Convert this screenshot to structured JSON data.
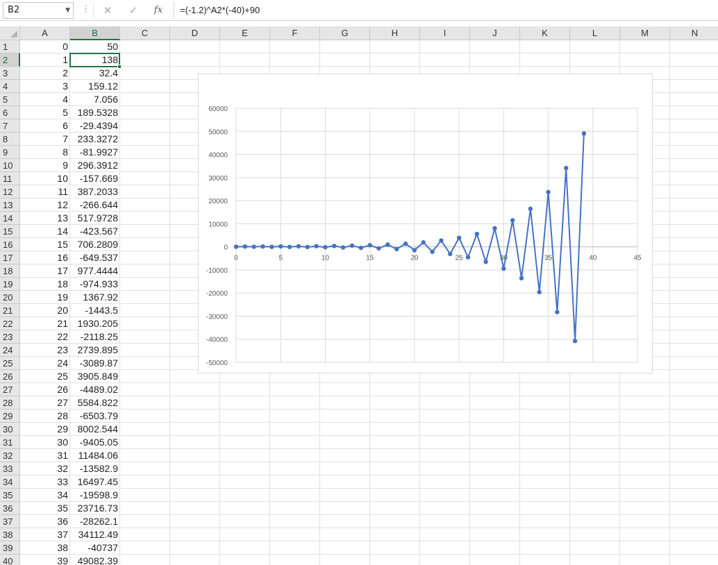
{
  "formula_bar": {
    "name_box": "B2",
    "name_box_icon": "chevron-down-icon",
    "more_icon": "vertical-dots-icon",
    "cancel_label": "✕",
    "enter_label": "✓",
    "fx_label": "fx",
    "formula": "=(-1.2)^A2*(-40)+90"
  },
  "columns": [
    "A",
    "B",
    "C",
    "D",
    "E",
    "F",
    "G",
    "H",
    "I",
    "J",
    "K",
    "L",
    "M",
    "N"
  ],
  "selected_column": "B",
  "selected_row": 2,
  "rows": [
    {
      "n": "1",
      "a": "0",
      "b": "50"
    },
    {
      "n": "2",
      "a": "1",
      "b": "138"
    },
    {
      "n": "3",
      "a": "2",
      "b": "32.4"
    },
    {
      "n": "4",
      "a": "3",
      "b": "159.12"
    },
    {
      "n": "5",
      "a": "4",
      "b": "7.056"
    },
    {
      "n": "6",
      "a": "5",
      "b": "189.5328"
    },
    {
      "n": "7",
      "a": "6",
      "b": "-29.4394"
    },
    {
      "n": "8",
      "a": "7",
      "b": "233.3272"
    },
    {
      "n": "9",
      "a": "8",
      "b": "-81.9927"
    },
    {
      "n": "10",
      "a": "9",
      "b": "296.3912"
    },
    {
      "n": "11",
      "a": "10",
      "b": "-157.669"
    },
    {
      "n": "12",
      "a": "11",
      "b": "387.2033"
    },
    {
      "n": "13",
      "a": "12",
      "b": "-266.644"
    },
    {
      "n": "14",
      "a": "13",
      "b": "517.9728"
    },
    {
      "n": "15",
      "a": "14",
      "b": "-423.567"
    },
    {
      "n": "16",
      "a": "15",
      "b": "706.2809"
    },
    {
      "n": "17",
      "a": "16",
      "b": "-649.537"
    },
    {
      "n": "18",
      "a": "17",
      "b": "977.4444"
    },
    {
      "n": "19",
      "a": "18",
      "b": "-974.933"
    },
    {
      "n": "20",
      "a": "19",
      "b": "1367.92"
    },
    {
      "n": "21",
      "a": "20",
      "b": "-1443.5"
    },
    {
      "n": "22",
      "a": "21",
      "b": "1930.205"
    },
    {
      "n": "23",
      "a": "22",
      "b": "-2118.25"
    },
    {
      "n": "24",
      "a": "23",
      "b": "2739.895"
    },
    {
      "n": "25",
      "a": "24",
      "b": "-3089.87"
    },
    {
      "n": "26",
      "a": "25",
      "b": "3905.849"
    },
    {
      "n": "27",
      "a": "26",
      "b": "-4489.02"
    },
    {
      "n": "28",
      "a": "27",
      "b": "5584.822"
    },
    {
      "n": "29",
      "a": "28",
      "b": "-6503.79"
    },
    {
      "n": "30",
      "a": "29",
      "b": "8002.544"
    },
    {
      "n": "31",
      "a": "30",
      "b": "-9405.05"
    },
    {
      "n": "32",
      "a": "31",
      "b": "11484.06"
    },
    {
      "n": "33",
      "a": "32",
      "b": "-13582.9"
    },
    {
      "n": "34",
      "a": "33",
      "b": "16497.45"
    },
    {
      "n": "35",
      "a": "34",
      "b": "-19598.9"
    },
    {
      "n": "36",
      "a": "35",
      "b": "23716.73"
    },
    {
      "n": "37",
      "a": "36",
      "b": "-28262.1"
    },
    {
      "n": "38",
      "a": "37",
      "b": "34112.49"
    },
    {
      "n": "39",
      "a": "38",
      "b": "-40737"
    },
    {
      "n": "40",
      "a": "39",
      "b": "49082.39"
    }
  ],
  "chart_data": {
    "type": "scatter",
    "title": "",
    "xlabel": "",
    "ylabel": "",
    "series_color": "#4472c4",
    "xlim": [
      0,
      45
    ],
    "ylim": [
      -50000,
      60000
    ],
    "x_ticks": [
      "0",
      "5",
      "10",
      "15",
      "20",
      "25",
      "30",
      "35",
      "40",
      "45"
    ],
    "y_ticks": [
      "60000",
      "50000",
      "40000",
      "30000",
      "20000",
      "10000",
      "0",
      "-10000",
      "-20000",
      "-30000",
      "-40000",
      "-50000"
    ],
    "grid": true,
    "x": [
      0,
      1,
      2,
      3,
      4,
      5,
      6,
      7,
      8,
      9,
      10,
      11,
      12,
      13,
      14,
      15,
      16,
      17,
      18,
      19,
      20,
      21,
      22,
      23,
      24,
      25,
      26,
      27,
      28,
      29,
      30,
      31,
      32,
      33,
      34,
      35,
      36,
      37,
      38,
      39
    ],
    "y": [
      50,
      138,
      32.4,
      159.12,
      7.056,
      189.5328,
      -29.4394,
      233.3272,
      -81.9927,
      296.3912,
      -157.669,
      387.2033,
      -266.644,
      517.9728,
      -423.567,
      706.2809,
      -649.537,
      977.4444,
      -974.933,
      1367.92,
      -1443.5,
      1930.205,
      -2118.25,
      2739.895,
      -3089.87,
      3905.849,
      -4489.02,
      5584.822,
      -6503.79,
      8002.544,
      -9405.05,
      11484.06,
      -13582.9,
      16497.45,
      -19598.9,
      23716.73,
      -28262.1,
      34112.49,
      -40737,
      49082.39
    ]
  }
}
